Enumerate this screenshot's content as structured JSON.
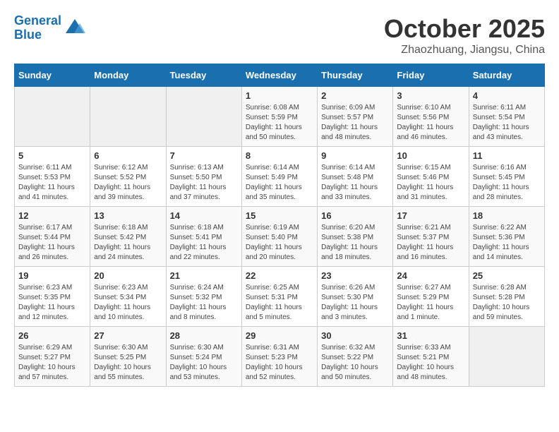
{
  "header": {
    "logo_line1": "General",
    "logo_line2": "Blue",
    "month": "October 2025",
    "location": "Zhaozhuang, Jiangsu, China"
  },
  "weekdays": [
    "Sunday",
    "Monday",
    "Tuesday",
    "Wednesday",
    "Thursday",
    "Friday",
    "Saturday"
  ],
  "weeks": [
    [
      {
        "day": "",
        "info": ""
      },
      {
        "day": "",
        "info": ""
      },
      {
        "day": "",
        "info": ""
      },
      {
        "day": "1",
        "info": "Sunrise: 6:08 AM\nSunset: 5:59 PM\nDaylight: 11 hours\nand 50 minutes."
      },
      {
        "day": "2",
        "info": "Sunrise: 6:09 AM\nSunset: 5:57 PM\nDaylight: 11 hours\nand 48 minutes."
      },
      {
        "day": "3",
        "info": "Sunrise: 6:10 AM\nSunset: 5:56 PM\nDaylight: 11 hours\nand 46 minutes."
      },
      {
        "day": "4",
        "info": "Sunrise: 6:11 AM\nSunset: 5:54 PM\nDaylight: 11 hours\nand 43 minutes."
      }
    ],
    [
      {
        "day": "5",
        "info": "Sunrise: 6:11 AM\nSunset: 5:53 PM\nDaylight: 11 hours\nand 41 minutes."
      },
      {
        "day": "6",
        "info": "Sunrise: 6:12 AM\nSunset: 5:52 PM\nDaylight: 11 hours\nand 39 minutes."
      },
      {
        "day": "7",
        "info": "Sunrise: 6:13 AM\nSunset: 5:50 PM\nDaylight: 11 hours\nand 37 minutes."
      },
      {
        "day": "8",
        "info": "Sunrise: 6:14 AM\nSunset: 5:49 PM\nDaylight: 11 hours\nand 35 minutes."
      },
      {
        "day": "9",
        "info": "Sunrise: 6:14 AM\nSunset: 5:48 PM\nDaylight: 11 hours\nand 33 minutes."
      },
      {
        "day": "10",
        "info": "Sunrise: 6:15 AM\nSunset: 5:46 PM\nDaylight: 11 hours\nand 31 minutes."
      },
      {
        "day": "11",
        "info": "Sunrise: 6:16 AM\nSunset: 5:45 PM\nDaylight: 11 hours\nand 28 minutes."
      }
    ],
    [
      {
        "day": "12",
        "info": "Sunrise: 6:17 AM\nSunset: 5:44 PM\nDaylight: 11 hours\nand 26 minutes."
      },
      {
        "day": "13",
        "info": "Sunrise: 6:18 AM\nSunset: 5:42 PM\nDaylight: 11 hours\nand 24 minutes."
      },
      {
        "day": "14",
        "info": "Sunrise: 6:18 AM\nSunset: 5:41 PM\nDaylight: 11 hours\nand 22 minutes."
      },
      {
        "day": "15",
        "info": "Sunrise: 6:19 AM\nSunset: 5:40 PM\nDaylight: 11 hours\nand 20 minutes."
      },
      {
        "day": "16",
        "info": "Sunrise: 6:20 AM\nSunset: 5:38 PM\nDaylight: 11 hours\nand 18 minutes."
      },
      {
        "day": "17",
        "info": "Sunrise: 6:21 AM\nSunset: 5:37 PM\nDaylight: 11 hours\nand 16 minutes."
      },
      {
        "day": "18",
        "info": "Sunrise: 6:22 AM\nSunset: 5:36 PM\nDaylight: 11 hours\nand 14 minutes."
      }
    ],
    [
      {
        "day": "19",
        "info": "Sunrise: 6:23 AM\nSunset: 5:35 PM\nDaylight: 11 hours\nand 12 minutes."
      },
      {
        "day": "20",
        "info": "Sunrise: 6:23 AM\nSunset: 5:34 PM\nDaylight: 11 hours\nand 10 minutes."
      },
      {
        "day": "21",
        "info": "Sunrise: 6:24 AM\nSunset: 5:32 PM\nDaylight: 11 hours\nand 8 minutes."
      },
      {
        "day": "22",
        "info": "Sunrise: 6:25 AM\nSunset: 5:31 PM\nDaylight: 11 hours\nand 5 minutes."
      },
      {
        "day": "23",
        "info": "Sunrise: 6:26 AM\nSunset: 5:30 PM\nDaylight: 11 hours\nand 3 minutes."
      },
      {
        "day": "24",
        "info": "Sunrise: 6:27 AM\nSunset: 5:29 PM\nDaylight: 11 hours\nand 1 minute."
      },
      {
        "day": "25",
        "info": "Sunrise: 6:28 AM\nSunset: 5:28 PM\nDaylight: 10 hours\nand 59 minutes."
      }
    ],
    [
      {
        "day": "26",
        "info": "Sunrise: 6:29 AM\nSunset: 5:27 PM\nDaylight: 10 hours\nand 57 minutes."
      },
      {
        "day": "27",
        "info": "Sunrise: 6:30 AM\nSunset: 5:25 PM\nDaylight: 10 hours\nand 55 minutes."
      },
      {
        "day": "28",
        "info": "Sunrise: 6:30 AM\nSunset: 5:24 PM\nDaylight: 10 hours\nand 53 minutes."
      },
      {
        "day": "29",
        "info": "Sunrise: 6:31 AM\nSunset: 5:23 PM\nDaylight: 10 hours\nand 52 minutes."
      },
      {
        "day": "30",
        "info": "Sunrise: 6:32 AM\nSunset: 5:22 PM\nDaylight: 10 hours\nand 50 minutes."
      },
      {
        "day": "31",
        "info": "Sunrise: 6:33 AM\nSunset: 5:21 PM\nDaylight: 10 hours\nand 48 minutes."
      },
      {
        "day": "",
        "info": ""
      }
    ]
  ]
}
